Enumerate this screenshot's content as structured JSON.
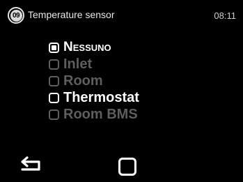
{
  "header": {
    "step_number": "09",
    "title": "Temperature sensor",
    "time": "08:11"
  },
  "options": [
    {
      "label": "Nessuno",
      "state": "selected"
    },
    {
      "label": "Inlet",
      "state": "disabled"
    },
    {
      "label": "Room",
      "state": "disabled"
    },
    {
      "label": "Thermostat",
      "state": "enabled"
    },
    {
      "label": "Room BMS",
      "state": "disabled"
    }
  ],
  "footer": {
    "back_icon": "back-arrow-icon",
    "confirm_icon": "square-confirm-icon"
  },
  "colors": {
    "background": "#000000",
    "active_text": "#ffffff",
    "disabled_text": "#5e5e5e"
  }
}
